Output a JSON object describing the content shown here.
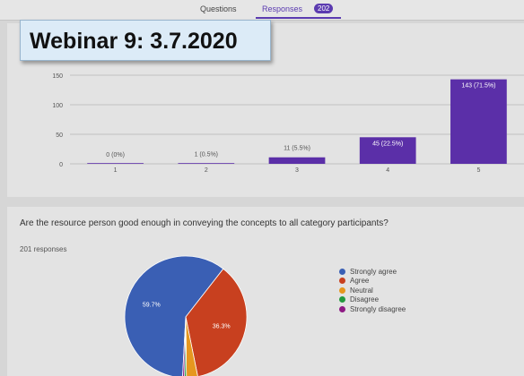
{
  "topbar": {
    "tab_questions": "Questions",
    "tab_responses": "Responses",
    "responses_count": "202"
  },
  "overlay_title": "Webinar 9: 3.7.2020",
  "chart_data": [
    {
      "type": "bar",
      "categories": [
        "1",
        "2",
        "3",
        "4",
        "5"
      ],
      "values": [
        0,
        1,
        11,
        45,
        143
      ],
      "data_labels": [
        "0 (0%)",
        "1 (0.5%)",
        "11 (5.5%)",
        "45 (22.5%)",
        "143 (71.5%)"
      ],
      "yticks": [
        "0",
        "50",
        "100",
        "150"
      ],
      "ylim": [
        0,
        150
      ],
      "grid": true,
      "color": "#5b2fa8"
    },
    {
      "type": "pie",
      "question": "Are the resource person good enough in conveying the concepts to all category participants?",
      "responses": "201 responses",
      "labels": [
        "Strongly agree",
        "Agree",
        "Neutral",
        "Disagree",
        "Strongly disagree"
      ],
      "values": [
        59.7,
        36.3,
        3.0,
        0.5,
        0.5
      ],
      "slice_labels": [
        "59.7%",
        "36.3%",
        "",
        "",
        ""
      ],
      "colors": [
        "#3a5fb4",
        "#c8401f",
        "#e6971f",
        "#239a3e",
        "#8e1a84"
      ],
      "legend_position": "right"
    }
  ]
}
